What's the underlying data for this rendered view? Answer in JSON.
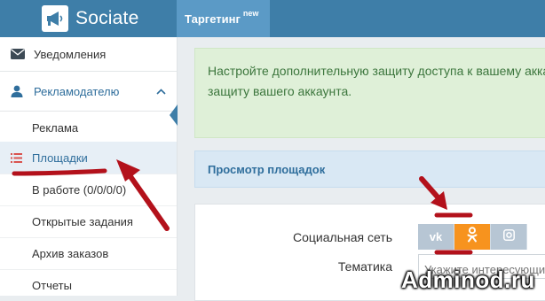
{
  "app": {
    "name": "Sociate"
  },
  "topnav": {
    "tab_label": "Таргетинг",
    "tab_badge": "new"
  },
  "sidebar": {
    "items": [
      {
        "label": "Уведомления",
        "icon": "envelope-icon"
      },
      {
        "label": "Рекламодателю",
        "icon": "user-icon",
        "expanded": true
      },
      {
        "label": "Реклама"
      },
      {
        "label": "Площадки",
        "icon": "list-icon",
        "active": true
      },
      {
        "label": "В работе (0/0/0/0)"
      },
      {
        "label": "Открытые задания"
      },
      {
        "label": "Архив заказов"
      },
      {
        "label": "Отчеты"
      }
    ]
  },
  "main": {
    "alert_line1": "Настройте дополнительную защиту доступа к вашему аккаунту",
    "alert_line2": "защиту вашего аккаунта.",
    "panel_title": "Просмотр площадок",
    "social_label": "Социальная сеть",
    "social_networks": [
      {
        "name": "vk",
        "text": "vk",
        "selected": false
      },
      {
        "name": "odnoklassniki",
        "selected": true
      },
      {
        "name": "instagram",
        "selected": false
      }
    ],
    "topic_label": "Тематика",
    "topic_placeholder": "Укажите интересующие"
  },
  "watermark": "Adminod.ru",
  "colors": {
    "header": "#3e7ea8",
    "active_tab": "#5b9ac6",
    "selected_network": "#f7931e",
    "annotation": "#b3111b"
  }
}
